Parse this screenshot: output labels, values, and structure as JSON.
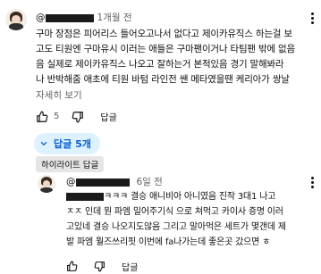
{
  "comment1": {
    "handle_prefix": "@",
    "time": "1개월 전",
    "lines": [
      "구마 장점은 피어리스 들어오고나서 없다고 제이카유직스 하는걸 보",
      "고도 티원엔 구마유시 이러는 애들은 구마팬이거나 타팀팬 밖에 없음",
      "음 실제로 제이카유직스 나오고 잘하는거 본적있음 경기 말해봐라",
      "나 반박해줌 애초에 티원 바텀 라인전 쌘 메타였을땐 케리아가 쌍날"
    ],
    "read_more": "자세히 보기",
    "like_count": "5",
    "reply_label": "답글"
  },
  "replies_toggle": {
    "label": "답글 5개"
  },
  "highlight_badge": "하이라이트 답글",
  "reply1": {
    "handle_prefix": "@",
    "time": "6일 전",
    "lines": [
      "ㅋㅋㅋ 결승 애니비아 아니였음 진작 3대1 나고",
      "ㅈㅈ 인데 뭔 파엠 밀어주기식 으로 쳐먹고 카이사 증명 이러",
      "고있네 결승 나오지도않음 그리고 말아먹은 세트가 몇갠데 제",
      "발 파엠 뭘즈쓰리핏 이번에 fa나가는데 좋은곳 갔으면 ㅎ"
    ],
    "reply_label": "답글"
  }
}
